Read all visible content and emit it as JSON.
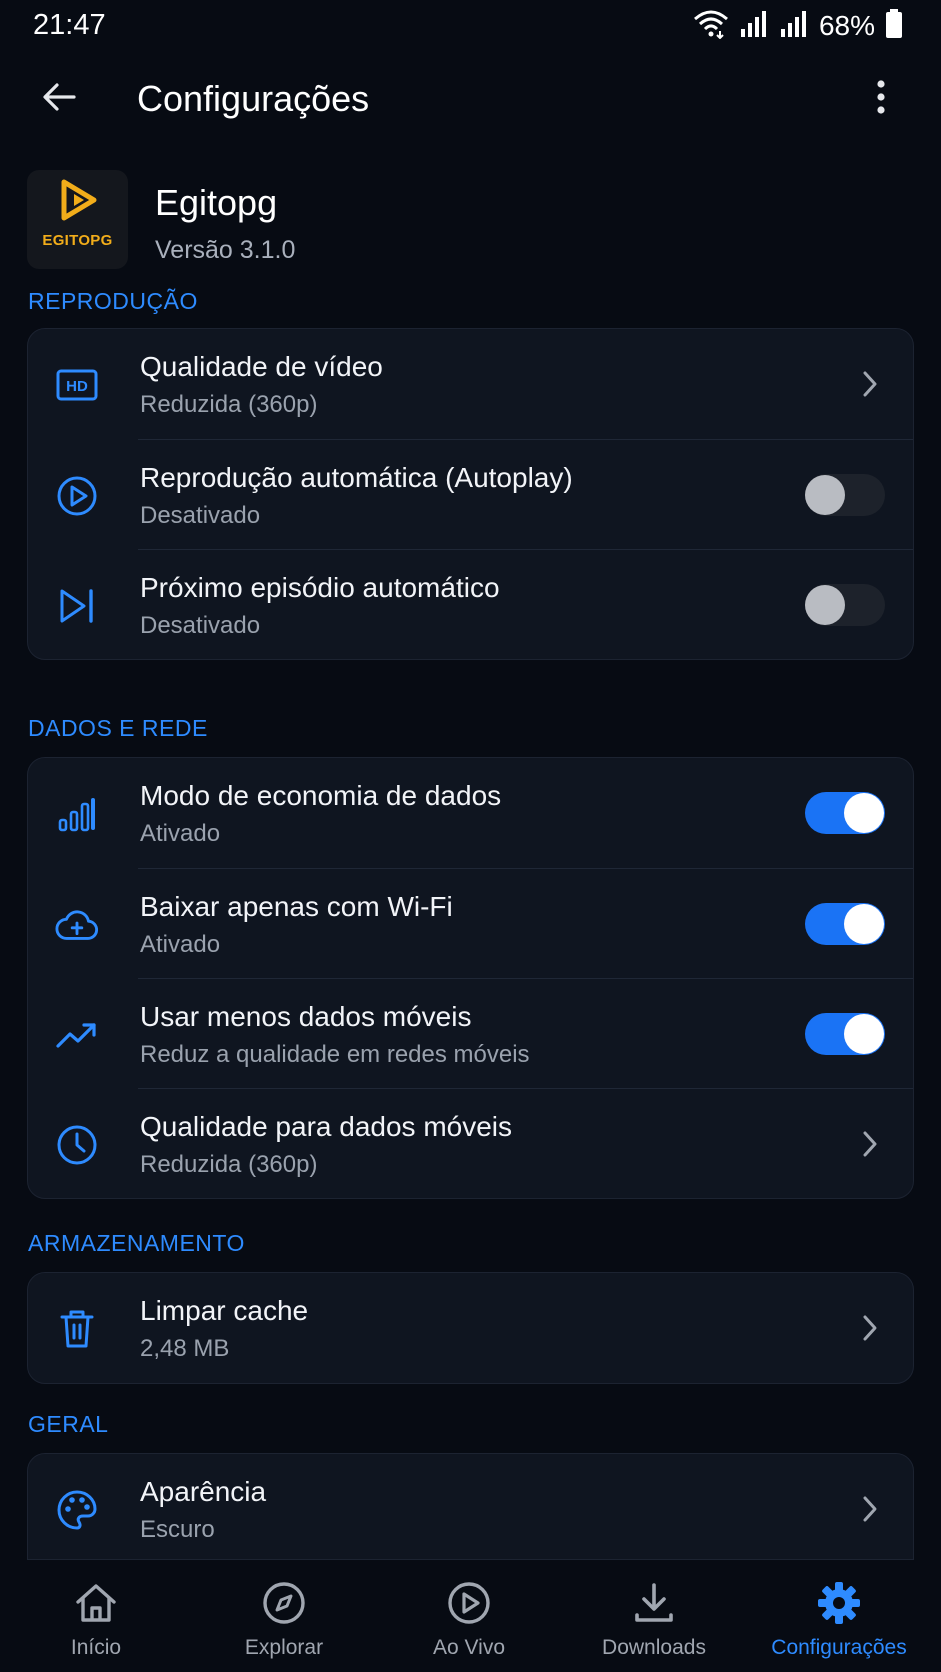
{
  "status_bar": {
    "time": "21:47",
    "battery": "68%",
    "icons": [
      "wifi-icon",
      "signal-icon",
      "signal-icon",
      "battery-icon"
    ]
  },
  "app_bar": {
    "title": "Configurações",
    "back_icon": "arrow-left-icon",
    "more_icon": "more-vertical-icon"
  },
  "app_info": {
    "name": "Egitopg",
    "version": "Versão 3.1.0",
    "logo_text": "EGITOPG"
  },
  "colors": {
    "accent": "#2e8bff",
    "toggle_on": "#1a73f5",
    "background": "#070b13",
    "card": "#0f1520",
    "logo_gold": "#f2ad1a"
  },
  "sections": [
    {
      "header": "REPRODUÇÃO",
      "items": [
        {
          "icon": "hd-icon",
          "title": "Qualidade de vídeo",
          "subtitle": "Reduzida (360p)",
          "control": "chevron"
        },
        {
          "icon": "play-circle-icon",
          "title": "Reprodução automática (Autoplay)",
          "subtitle": "Desativado",
          "control": "toggle",
          "on": false
        },
        {
          "icon": "skip-next-icon",
          "title": "Próximo episódio automático",
          "subtitle": "Desativado",
          "control": "toggle",
          "on": false
        }
      ]
    },
    {
      "header": "DADOS E REDE",
      "items": [
        {
          "icon": "bar-chart-icon",
          "title": "Modo de economia de dados",
          "subtitle": "Ativado",
          "control": "toggle",
          "on": true
        },
        {
          "icon": "cloud-upload-icon",
          "title": "Baixar apenas com Wi-Fi",
          "subtitle": "Ativado",
          "control": "toggle",
          "on": true
        },
        {
          "icon": "trending-up-icon",
          "title": "Usar menos dados móveis",
          "subtitle": "Reduz a qualidade em redes móveis",
          "control": "toggle",
          "on": true
        },
        {
          "icon": "clock-icon",
          "title": "Qualidade para dados móveis",
          "subtitle": "Reduzida (360p)",
          "control": "chevron"
        }
      ]
    },
    {
      "header": "ARMAZENAMENTO",
      "items": [
        {
          "icon": "trash-icon",
          "title": "Limpar cache",
          "subtitle": "2,48 MB",
          "control": "chevron"
        }
      ]
    },
    {
      "header": "GERAL",
      "items": [
        {
          "icon": "palette-icon",
          "title": "Aparência",
          "subtitle": "Escuro",
          "control": "chevron"
        }
      ]
    }
  ],
  "bottom_nav": [
    {
      "icon": "home-icon",
      "label": "Início",
      "active": false
    },
    {
      "icon": "compass-icon",
      "label": "Explorar",
      "active": false
    },
    {
      "icon": "play-circle-icon",
      "label": "Ao Vivo",
      "active": false
    },
    {
      "icon": "download-icon",
      "label": "Downloads",
      "active": false
    },
    {
      "icon": "gear-icon",
      "label": "Configurações",
      "active": true
    }
  ]
}
